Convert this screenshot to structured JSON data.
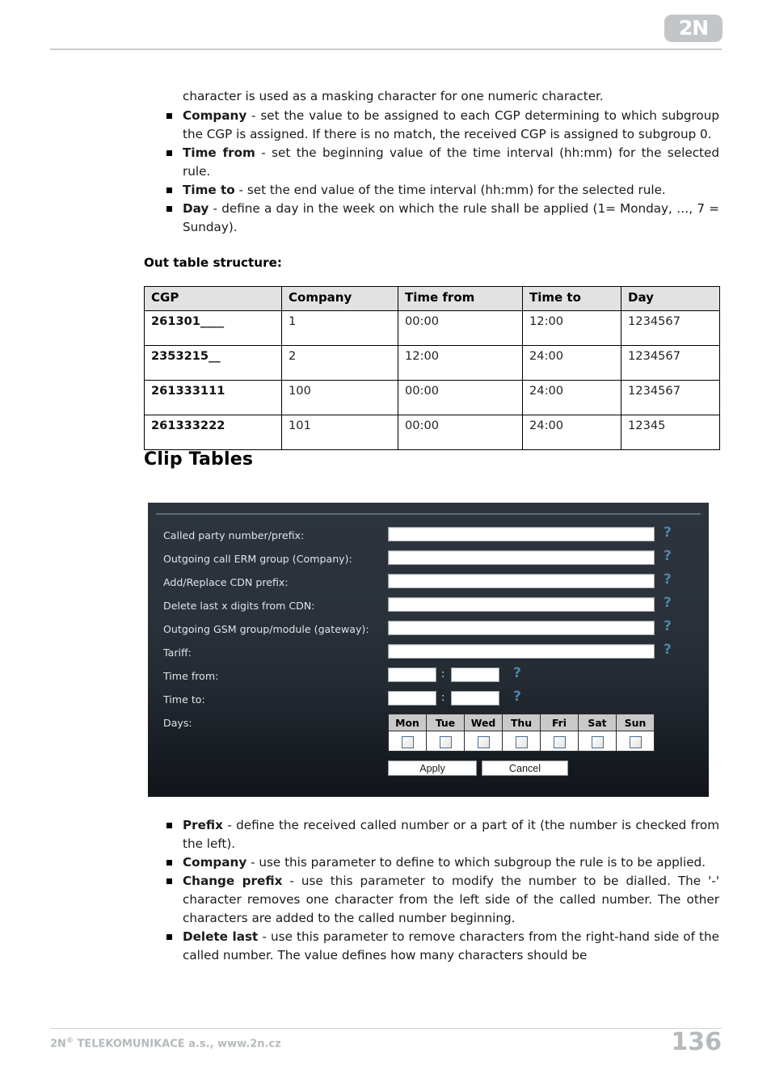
{
  "header": {
    "logo_text": "2N"
  },
  "intro": {
    "lead_paragraph": "character is used as a masking character for one numeric character."
  },
  "top_bullets": [
    {
      "term": "Company",
      "text": " - set the value to be assigned to each CGP determining to which subgroup the CGP is assigned. If there is no match, the received CGP is assigned to subgroup 0."
    },
    {
      "term": "Time from",
      "text": " - set the beginning value of the time interval (hh:mm) for the selected rule."
    },
    {
      "term": "Time to",
      "text": " - set the end value of the time interval (hh:mm) for the selected rule."
    },
    {
      "term": "Day",
      "text": " - define a day in the week on which the rule shall be applied (1= Monday, …, 7 = Sunday)."
    }
  ],
  "out_table": {
    "title": "Out table structure:",
    "columns": [
      "CGP",
      "Company",
      "Time from",
      "Time to",
      "Day"
    ],
    "rows": [
      [
        "261301____",
        "1",
        "00:00",
        "12:00",
        "1234567"
      ],
      [
        "2353215__",
        "2",
        "12:00",
        "24:00",
        "1234567"
      ],
      [
        "261333111",
        "100",
        "00:00",
        "24:00",
        "1234567"
      ],
      [
        "261333222",
        "101",
        "00:00",
        "24:00",
        "12345"
      ]
    ]
  },
  "clip_tables": {
    "heading": "Clip Tables",
    "form": {
      "fields": [
        {
          "label": "Called party number/prefix:",
          "value": "",
          "help": "?"
        },
        {
          "label": "Outgoing call ERM group (Company):",
          "value": "",
          "help": "?"
        },
        {
          "label": "Add/Replace CDN prefix:",
          "value": "",
          "help": "?"
        },
        {
          "label": "Delete last x digits from CDN:",
          "value": "",
          "help": "?"
        },
        {
          "label": "Outgoing GSM group/module (gateway):",
          "value": "",
          "help": "?"
        },
        {
          "label": "Tariff:",
          "value": "",
          "help": "?"
        }
      ],
      "time_from": {
        "label": "Time from:",
        "hours": "",
        "minutes": "",
        "separator": ":",
        "help": "?"
      },
      "time_to": {
        "label": "Time to:",
        "hours": "",
        "minutes": "",
        "separator": ":",
        "help": "?"
      },
      "days": {
        "label": "Days:",
        "names": [
          "Mon",
          "Tue",
          "Wed",
          "Thu",
          "Fri",
          "Sat",
          "Sun"
        ],
        "checked": [
          false,
          false,
          false,
          false,
          false,
          false,
          false
        ]
      },
      "buttons": {
        "apply": "Apply",
        "cancel": "Cancel"
      }
    }
  },
  "bottom_bullets": [
    {
      "term": "Prefix",
      "text": " - define the received called number or a part of it (the number is checked from the left)."
    },
    {
      "term": "Company",
      "text": " - use this parameter to define to which subgroup the rule is to be applied."
    },
    {
      "term": "Change prefix",
      "text": " - use this parameter to modify the number to be dialled. The '-' character removes one character from the left side of the called number. The other characters are added to the called number beginning."
    },
    {
      "term": "Delete last",
      "text": " - use this parameter to remove characters from the right-hand side of the called number. The value defines how many characters should be"
    }
  ],
  "footer": {
    "company_prefix": "2N",
    "registered_mark": "®",
    "company_suffix": " TELEKOMUNIKACE a.s., www.2n.cz",
    "page_number": "136"
  },
  "colors": {
    "panel_dark": "#2d343d",
    "panel_dark_bottom": "#11151a",
    "help_blue": "#4e85ab",
    "table_header_grey": "#e2e2e2",
    "footer_grey": "#b6babd"
  }
}
